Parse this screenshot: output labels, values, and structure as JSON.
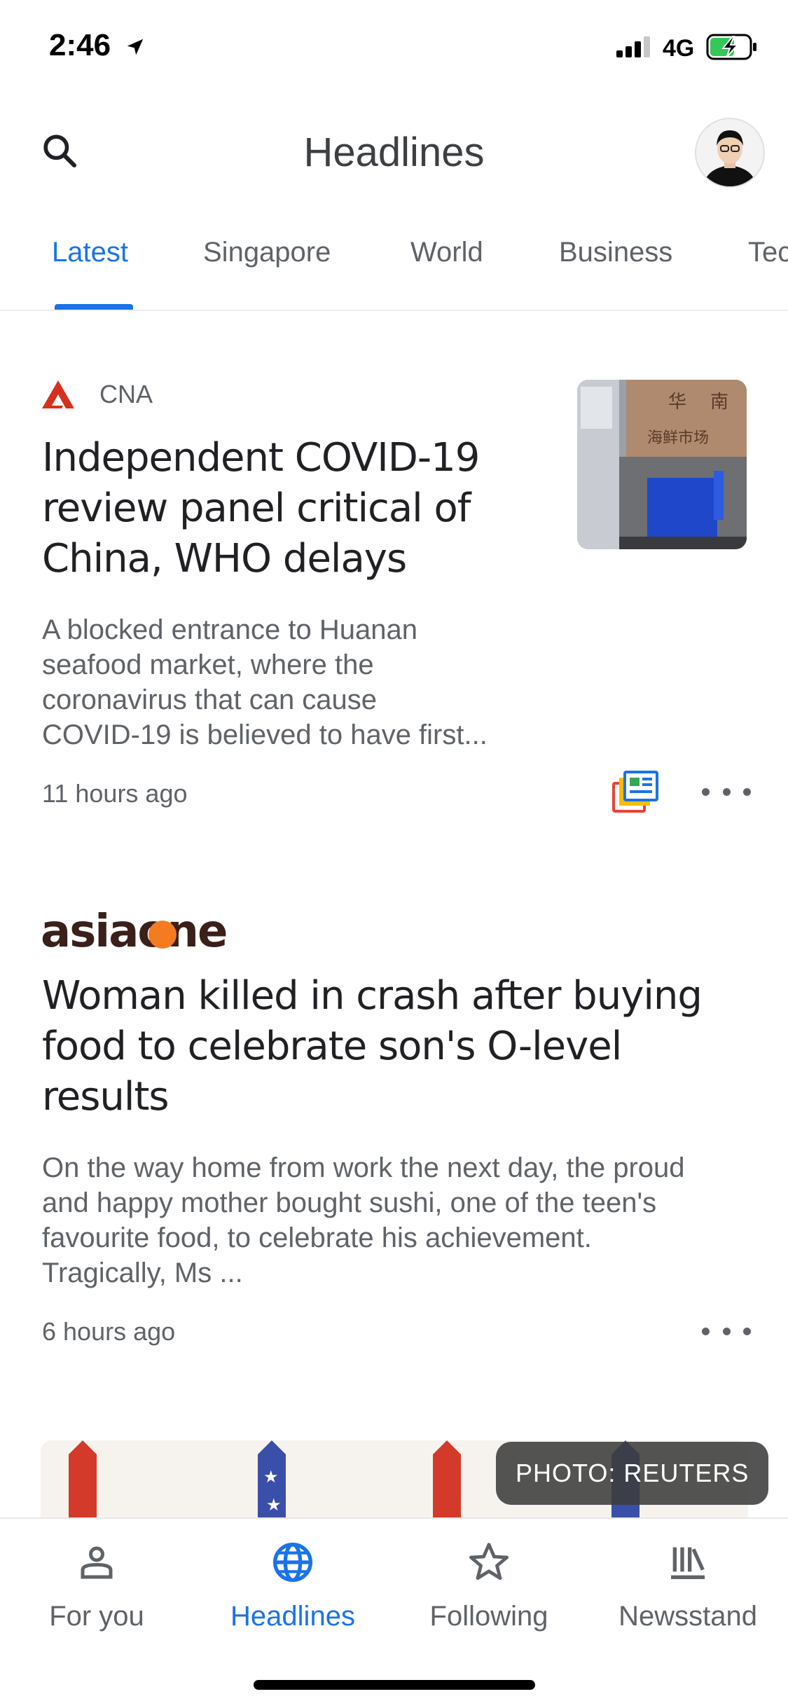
{
  "status_bar": {
    "time": "2:46",
    "network": "4G"
  },
  "header": {
    "title": "Headlines"
  },
  "tabs": [
    {
      "label": "Latest",
      "active": true
    },
    {
      "label": "Singapore"
    },
    {
      "label": "World"
    },
    {
      "label": "Business"
    },
    {
      "label": "Tec"
    }
  ],
  "articles": [
    {
      "source": "CNA",
      "headline_lines": [
        "Independent COVID-19",
        "review panel critical of",
        "China, WHO delays"
      ],
      "snippet_lines": [
        "A blocked entrance to Huanan",
        "seafood market, where the",
        "coronavirus that can cause",
        "COVID-19 is believed to have first..."
      ],
      "time": "11 hours ago",
      "thumb_sign": "华 南 海 鲜 市 场"
    },
    {
      "source_logo_text": "asiaone",
      "headline_lines": [
        "Woman killed in crash after buying",
        "food to celebrate son's O-level",
        "results"
      ],
      "snippet_lines": [
        "On the way home from work the next day, the proud",
        "and happy mother bought sushi, one of the teen's",
        "favourite food, to celebrate his achievement.",
        "Tragically, Ms ..."
      ],
      "time": "6 hours ago"
    }
  ],
  "photo_credit": "PHOTO: REUTERS",
  "bottom_nav": [
    {
      "label": "For you",
      "icon": "for-you-icon"
    },
    {
      "label": "Headlines",
      "icon": "globe-icon",
      "active": true
    },
    {
      "label": "Following",
      "icon": "star-icon"
    },
    {
      "label": "Newsstand",
      "icon": "newsstand-icon"
    }
  ],
  "colors": {
    "accent": "#1a73e8",
    "cna_red": "#d6301f",
    "asiaone_dark": "#3a1f1a",
    "asiaone_orange": "#f47b20"
  }
}
